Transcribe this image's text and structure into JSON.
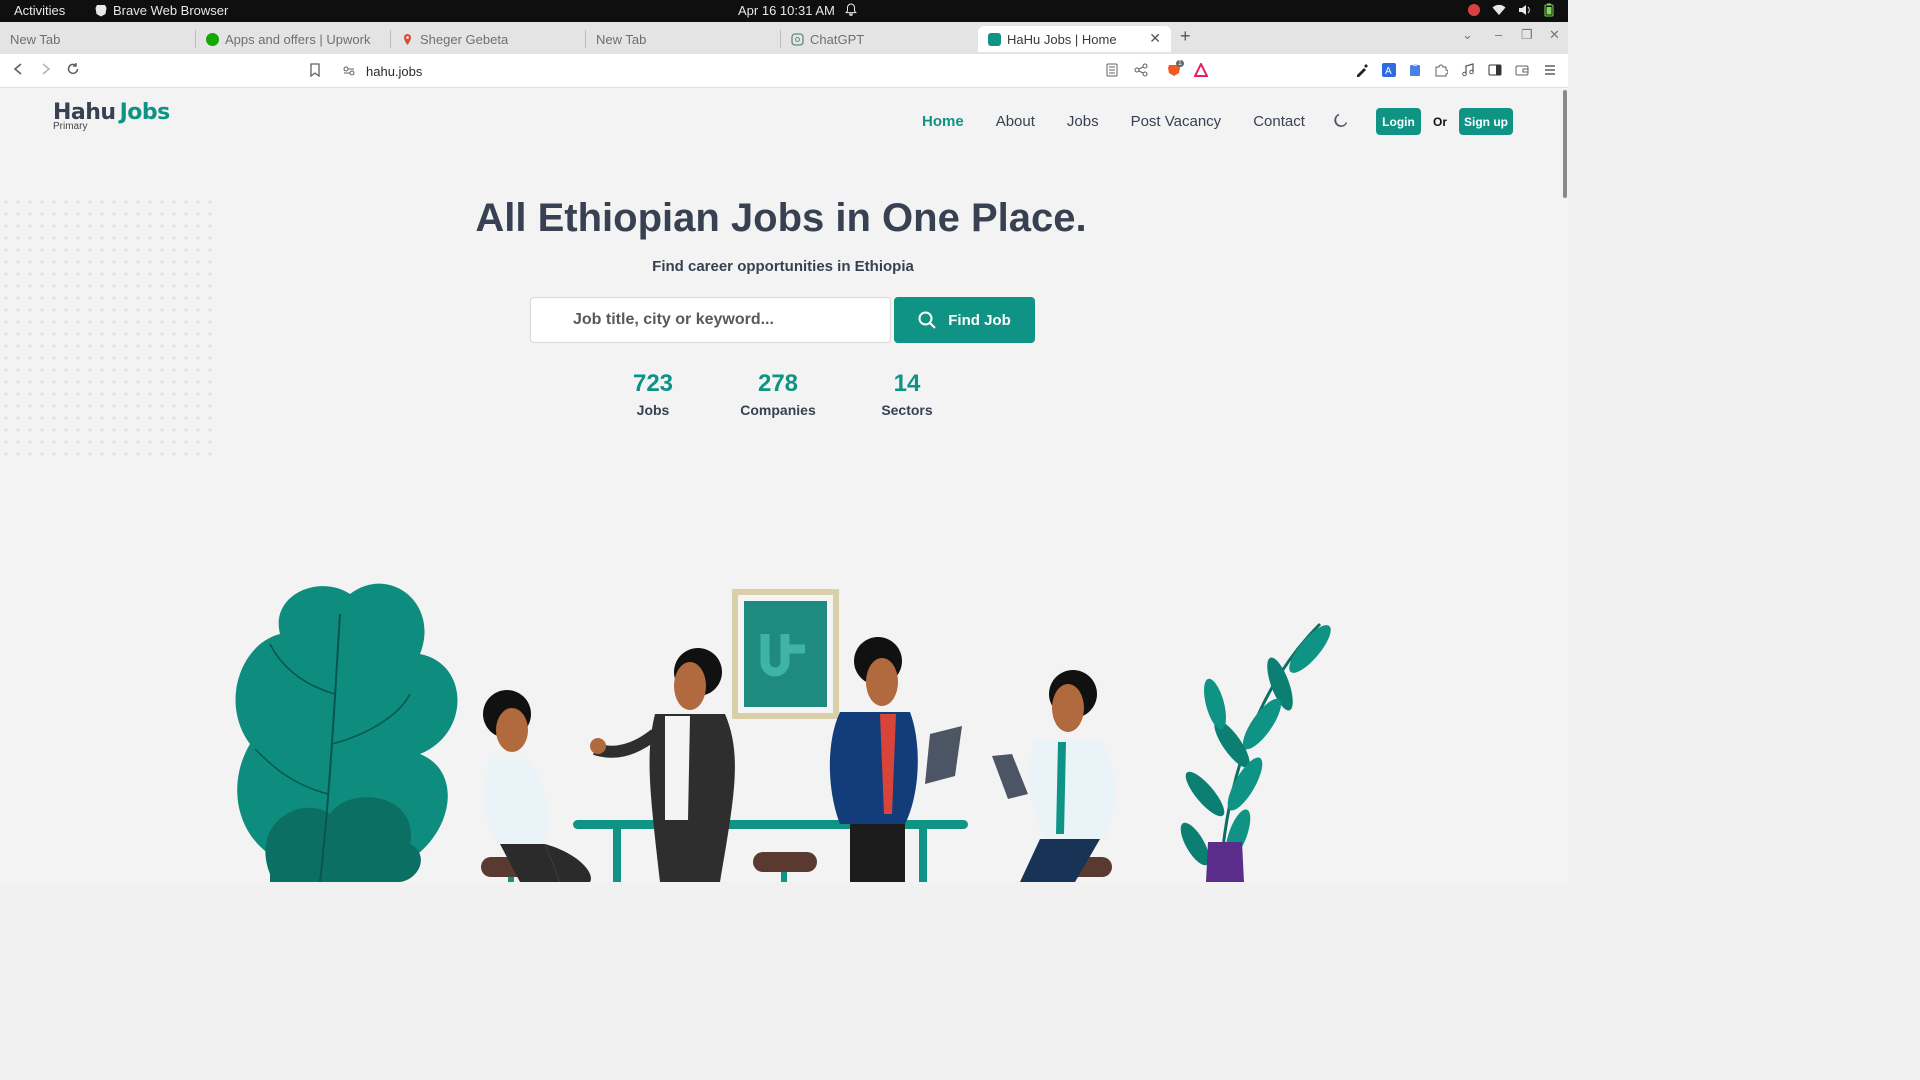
{
  "system_bar": {
    "activities": "Activities",
    "app_name": "Brave Web Browser",
    "datetime": "Apr 16  10:31 AM"
  },
  "tabs": [
    {
      "title": "New Tab",
      "icon": "none"
    },
    {
      "title": "Apps and offers | Upwork",
      "icon": "upwork-icon"
    },
    {
      "title": "Sheger Gebeta",
      "icon": "map-pin-icon"
    },
    {
      "title": "New Tab",
      "icon": "none"
    },
    {
      "title": "ChatGPT",
      "icon": "chatgpt-icon"
    },
    {
      "title": "HaHu Jobs | Home",
      "icon": "hahu-icon",
      "active": true
    }
  ],
  "address_bar": {
    "url": "hahu.jobs",
    "brave_badge_count": "1"
  },
  "site": {
    "logo_left": "Hahu",
    "logo_right": "Jobs",
    "logo_sub": "Primary",
    "nav": [
      "Home",
      "About",
      "Jobs",
      "Post Vacancy",
      "Contact"
    ],
    "active_nav": "Home",
    "login_label": "Login",
    "or_label": "Or",
    "signup_label": "Sign up"
  },
  "hero": {
    "title": "All Ethiopian Jobs in One Place.",
    "subtitle": "Find career opportunities in Ethiopia",
    "search_placeholder": "Job title, city or keyword...",
    "find_button": "Find Job"
  },
  "stats": [
    {
      "value": "723",
      "label": "Jobs"
    },
    {
      "value": "278",
      "label": "Companies"
    },
    {
      "value": "14",
      "label": "Sectors"
    }
  ],
  "colors": {
    "brand": "#0e9384",
    "heading": "#374151"
  }
}
